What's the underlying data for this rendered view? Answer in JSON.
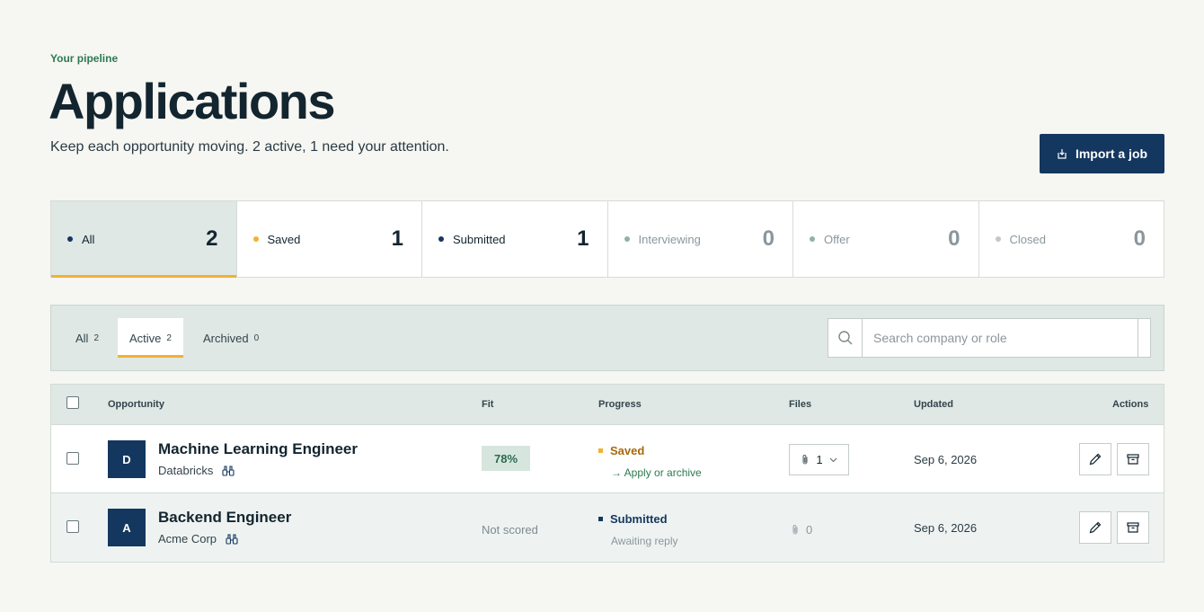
{
  "header": {
    "eyebrow": "Your pipeline",
    "title": "Applications",
    "subtitle": "Keep each opportunity moving. 2 active, 1 need your attention.",
    "import_label": "Import a job"
  },
  "stages": [
    {
      "label": "All",
      "count": "2",
      "color": "#14375f",
      "active": true
    },
    {
      "label": "Saved",
      "count": "1",
      "color": "#f2b130"
    },
    {
      "label": "Submitted",
      "count": "1",
      "color": "#14375f"
    },
    {
      "label": "Interviewing",
      "count": "0",
      "color": "#8fb3a2"
    },
    {
      "label": "Offer",
      "count": "0",
      "color": "#8fb3a2"
    },
    {
      "label": "Closed",
      "count": "0",
      "color": "#c2c7c9"
    }
  ],
  "tabs": [
    {
      "label": "All",
      "count": "2"
    },
    {
      "label": "Active",
      "count": "2",
      "active": true
    },
    {
      "label": "Archived",
      "count": "0"
    }
  ],
  "search": {
    "placeholder": "Search company or role",
    "value": ""
  },
  "table": {
    "columns": {
      "opportunity": "Opportunity",
      "fit": "Fit",
      "progress": "Progress",
      "files": "Files",
      "updated": "Updated",
      "actions": "Actions"
    },
    "rows": [
      {
        "initial": "D",
        "role": "Machine Learning Engineer",
        "company": "Databricks",
        "fit": "78%",
        "status": "Saved",
        "status_color": "#a8690b",
        "next": "Apply or archive",
        "files": "1",
        "updated": "Sep 6, 2026"
      },
      {
        "initial": "A",
        "role": "Backend Engineer",
        "company": "Acme Corp",
        "fit": "Not scored",
        "status": "Submitted",
        "status_color": "#14375f",
        "next": "Awaiting reply",
        "files": "0",
        "updated": "Sep 6, 2026"
      }
    ]
  }
}
